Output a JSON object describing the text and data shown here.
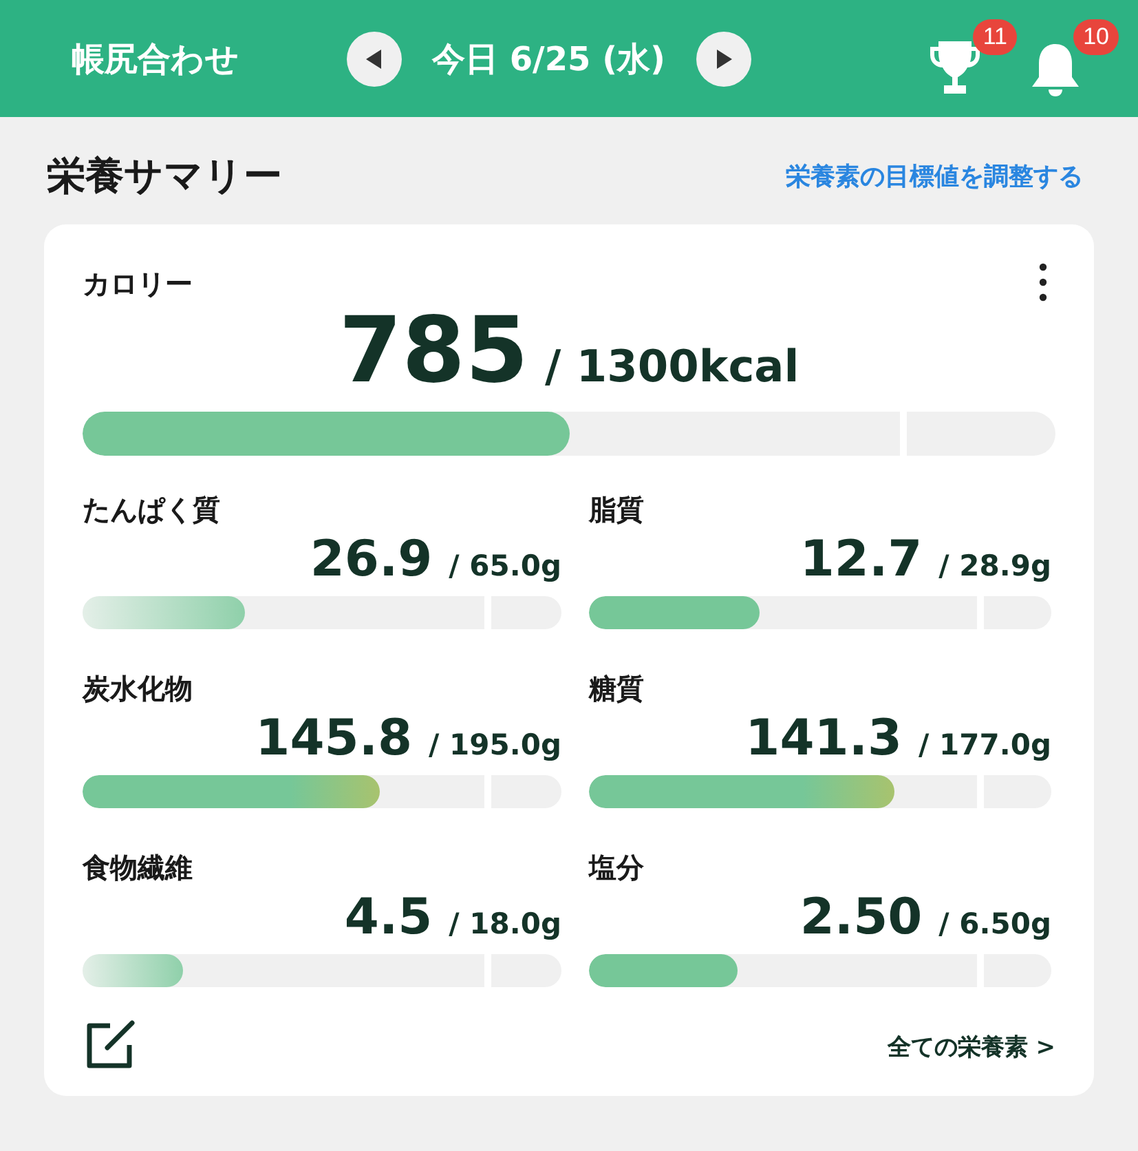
{
  "header": {
    "title": "帳尻合わせ",
    "date": "今日 6/25 (水)",
    "trophy_badge": "11",
    "bell_badge": "10"
  },
  "section": {
    "title": "栄養サマリー",
    "link": "栄養素の目標値を調整する"
  },
  "calorie": {
    "label": "カロリー",
    "value": "785",
    "target": "/ 1300kcal",
    "level": 0.5,
    "kind": "ok"
  },
  "nutrients": [
    {
      "label": "たんぱく質",
      "value": "26.9",
      "target": "/ 65.0g",
      "level": 0.34,
      "kind": "low"
    },
    {
      "label": "脂質",
      "value": "12.7",
      "target": "/ 28.9g",
      "level": 0.37,
      "kind": "ok"
    },
    {
      "label": "炭水化物",
      "value": "145.8",
      "target": "/ 195.0g",
      "level": 0.62,
      "kind": "high"
    },
    {
      "label": "糖質",
      "value": "141.3",
      "target": "/ 177.0g",
      "level": 0.66,
      "kind": "high"
    },
    {
      "label": "食物繊維",
      "value": "4.5",
      "target": "/ 18.0g",
      "level": 0.21,
      "kind": "low"
    },
    {
      "label": "塩分",
      "value": "2.50",
      "target": "/ 6.50g",
      "level": 0.32,
      "kind": "ok"
    }
  ],
  "footer_link": "全ての栄養素 >"
}
